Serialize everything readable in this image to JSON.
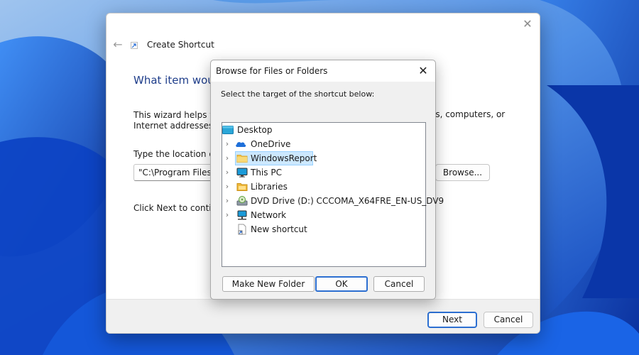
{
  "wizard": {
    "title": "Create Shortcut",
    "heading": "What item woul",
    "description_line1": "This wizard helps yo",
    "description_tail": "ers, computers, or",
    "description_line2": "Internet addresses.",
    "location_label": "Type the location of t",
    "location_value": "\"C:\\Program Files\\C",
    "browse_label": "Browse...",
    "click_next": "Click Next to continu",
    "next_label": "Next",
    "cancel_label": "Cancel"
  },
  "dialog": {
    "title": "Browse for Files or Folders",
    "instruction": "Select the target of the shortcut below:",
    "tree": [
      {
        "label": "Desktop",
        "icon": "desktop-folder-icon",
        "expandable": false,
        "selected": false
      },
      {
        "label": "OneDrive",
        "icon": "onedrive-cloud-icon",
        "expandable": true,
        "selected": false
      },
      {
        "label": "WindowsReport",
        "icon": "folder-icon",
        "expandable": true,
        "selected": true
      },
      {
        "label": "This PC",
        "icon": "monitor-icon",
        "expandable": true,
        "selected": false
      },
      {
        "label": "Libraries",
        "icon": "libraries-folder-icon",
        "expandable": true,
        "selected": false
      },
      {
        "label": "DVD Drive (D:) CCCOMA_X64FRE_EN-US_DV9",
        "icon": "dvd-drive-icon",
        "expandable": true,
        "selected": false
      },
      {
        "label": "Network",
        "icon": "network-icon",
        "expandable": true,
        "selected": false
      },
      {
        "label": "New shortcut",
        "icon": "shortcut-file-icon",
        "expandable": false,
        "selected": false
      }
    ],
    "make_new_folder_label": "Make New Folder",
    "ok_label": "OK",
    "cancel_label": "Cancel"
  },
  "colors": {
    "accent": "#2c6fd1",
    "selection": "#cce8ff",
    "heading": "#1e3d8a"
  }
}
